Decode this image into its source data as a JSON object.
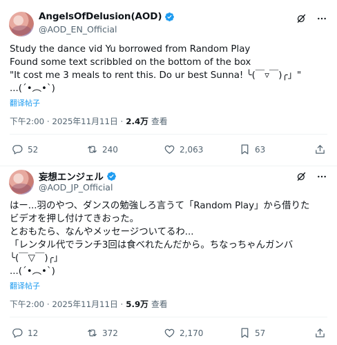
{
  "posts": [
    {
      "display_name": "AngelsOfDelusion(AOD)",
      "handle": "@AOD_EN_Official",
      "text": "Study the dance vid Yu borrowed from Random Play\nFound some text scribbled on the bottom of the box\n\"It cost me 3 meals to rent this. Do ur best Sunna! ╰(￣▿￣)╭」\"\n...(´•︵•`)",
      "translate_label": "翻译帖子",
      "time": "下午2:00 · 2025年11月11日 ·",
      "views_count": "2.4万",
      "views_label": "查看",
      "actions": {
        "replies": "52",
        "reposts": "240",
        "likes": "2,063",
        "bookmarks": "63"
      }
    },
    {
      "display_name": "妄想エンジェル",
      "handle": "@AOD_JP_Official",
      "text": "はー...羽のやつ、ダンスの勉強しろ言うて「Random Play」から借りた\nビデオを押し付けてきおった。\nとおもたら、なんやメッセージついてるわ...\n「レンタル代でランチ3回は食べれたんだから。ちなっちゃんガンバ\n╰(￣▽￣)╭」\n...(´•︵•`)",
      "translate_label": "翻译帖子",
      "time": "下午2:00 · 2025年11月11日 ·",
      "views_count": "5.9万",
      "views_label": "查看",
      "actions": {
        "replies": "12",
        "reposts": "372",
        "likes": "2,170",
        "bookmarks": "57"
      }
    }
  ],
  "colors": {
    "accent": "#1d9bf0",
    "muted": "#536471",
    "text": "#0f1419",
    "divider": "#eff3f4"
  },
  "icons": [
    "verified-badge-icon",
    "grok-icon",
    "more-icon",
    "reply-icon",
    "repost-icon",
    "like-icon",
    "bookmark-icon",
    "share-icon"
  ]
}
